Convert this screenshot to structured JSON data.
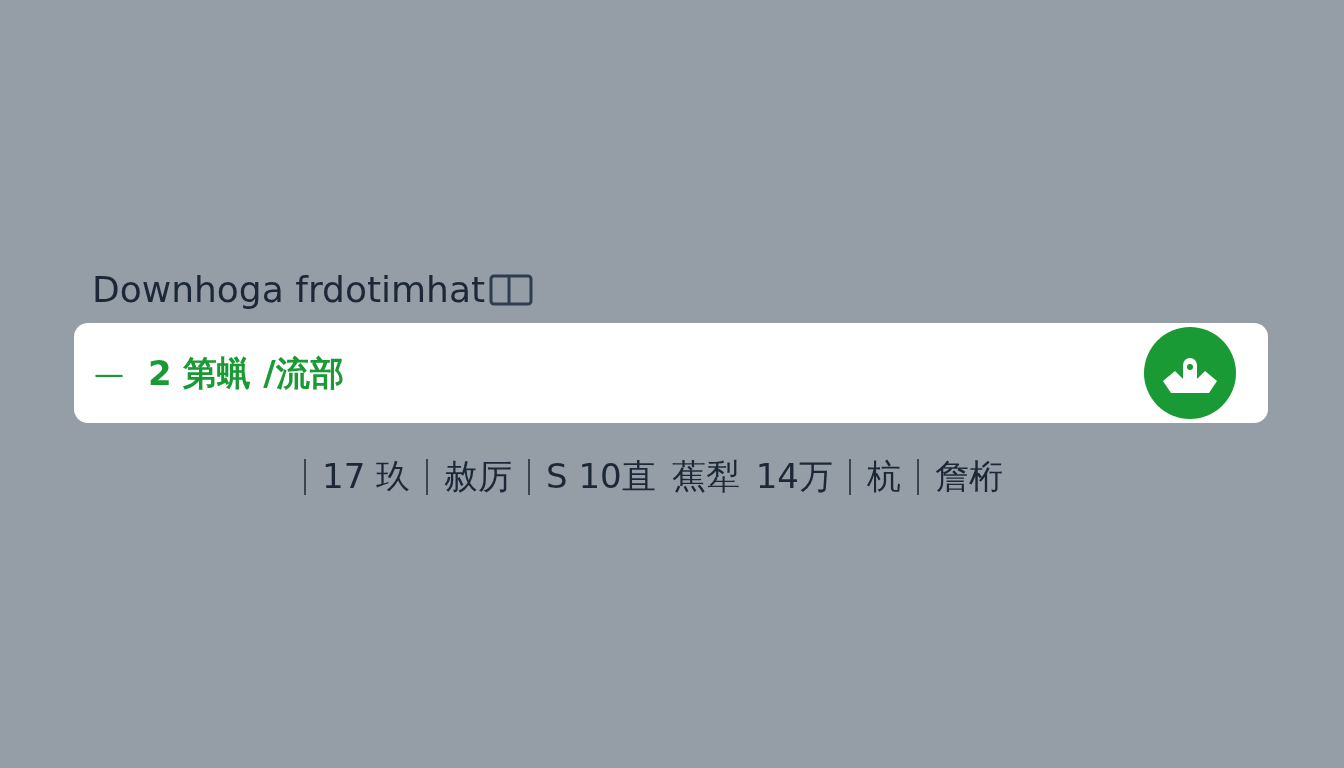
{
  "title": "Downhoga frdotimhat",
  "search": {
    "prefix": "—",
    "value": "2 第蝋 /流部"
  },
  "stats": [
    {
      "kind": "divider"
    },
    {
      "kind": "text",
      "text": "17 玖"
    },
    {
      "kind": "divider"
    },
    {
      "kind": "text",
      "text": "赦厉"
    },
    {
      "kind": "divider"
    },
    {
      "kind": "text",
      "text": "S 10直"
    },
    {
      "kind": "text",
      "text": "蕉犁"
    },
    {
      "kind": "text",
      "text": "14万"
    },
    {
      "kind": "divider"
    },
    {
      "kind": "text",
      "text": "杭"
    },
    {
      "kind": "divider"
    },
    {
      "kind": "text",
      "text": "詹桁"
    }
  ]
}
